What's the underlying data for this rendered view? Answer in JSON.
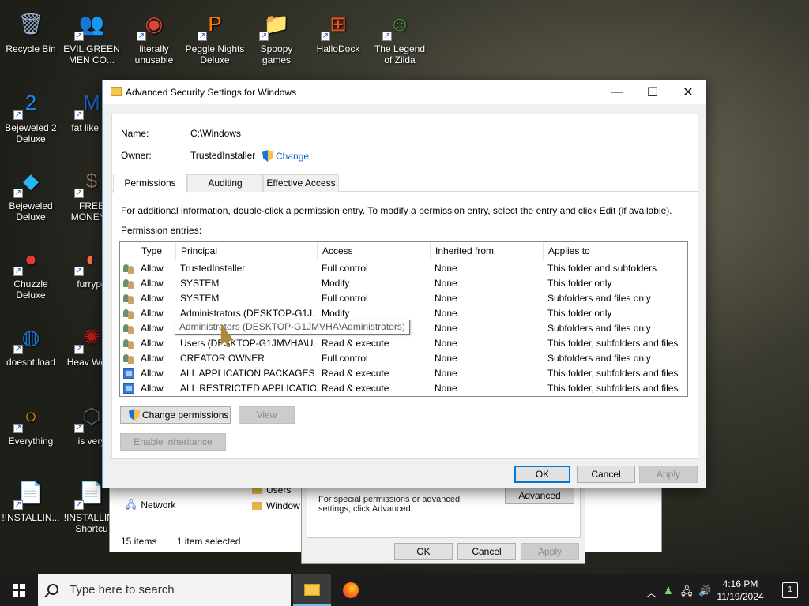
{
  "desktop": {
    "icons": [
      {
        "label": "Recycle Bin",
        "glyph": "🗑"
      },
      {
        "label": "EVIL GREEN MEN CO...",
        "glyph": "👥"
      },
      {
        "label": "literally unusable",
        "glyph": "◉"
      },
      {
        "label": "Peggle Nights Deluxe",
        "glyph": "P"
      },
      {
        "label": "Spoopy games",
        "glyph": "📁"
      },
      {
        "label": "HalloDock",
        "glyph": "⊞"
      },
      {
        "label": "The Legend of Zilda",
        "glyph": "☺"
      },
      {
        "label": "Bejeweled 2 Deluxe",
        "glyph": "2"
      },
      {
        "label": "fat like da",
        "glyph": "M"
      },
      {
        "label": "Bejeweled Deluxe",
        "glyph": "◆"
      },
      {
        "label": "FREE MONEY.e",
        "glyph": "$"
      },
      {
        "label": "Chuzzle Deluxe",
        "glyph": "●"
      },
      {
        "label": "furrypo",
        "glyph": "◐"
      },
      {
        "label": "doesnt load",
        "glyph": "◍"
      },
      {
        "label": "Heav Weap",
        "glyph": "✺"
      },
      {
        "label": "Everything",
        "glyph": "○"
      },
      {
        "label": "is very",
        "glyph": "⬡"
      },
      {
        "label": "!INSTALLIN...",
        "glyph": "📄"
      },
      {
        "label": "!INSTALLIN - Shortcu",
        "glyph": "📄"
      }
    ]
  },
  "background_explorer": {
    "nav_network": "Network",
    "folders": [
      "Users",
      "Window"
    ],
    "status_items": "15 items",
    "status_selected": "1 item selected"
  },
  "background_props": {
    "text": "For special permissions or advanced settings, click Advanced.",
    "advanced_button": "Advanced",
    "ok": "OK",
    "cancel": "Cancel",
    "apply": "Apply"
  },
  "dialog": {
    "title": "Advanced Security Settings for Windows",
    "name_label": "Name:",
    "name_value": "C:\\Windows",
    "owner_label": "Owner:",
    "owner_value": "TrustedInstaller",
    "owner_change": "Change",
    "tabs": [
      "Permissions",
      "Auditing",
      "Effective Access"
    ],
    "info_text": "For additional information, double-click a permission entry. To modify a permission entry, select the entry and click Edit (if available).",
    "entries_label": "Permission entries:",
    "columns": [
      "Type",
      "Principal",
      "Access",
      "Inherited from",
      "Applies to"
    ],
    "rows": [
      {
        "icon": "users-icon",
        "type": "Allow",
        "principal": "TrustedInstaller",
        "access": "Full control",
        "inherited": "None",
        "applies": "This folder and subfolders"
      },
      {
        "icon": "users-icon",
        "type": "Allow",
        "principal": "SYSTEM",
        "access": "Modify",
        "inherited": "None",
        "applies": "This folder only"
      },
      {
        "icon": "users-icon",
        "type": "Allow",
        "principal": "SYSTEM",
        "access": "Full control",
        "inherited": "None",
        "applies": "Subfolders and files only"
      },
      {
        "icon": "users-icon",
        "type": "Allow",
        "principal": "Administrators (DESKTOP-G1J...",
        "access": "Modify",
        "inherited": "None",
        "applies": "This folder only"
      },
      {
        "icon": "users-icon",
        "type": "Allow",
        "principal": "Administrators (DESKTOP-G1J...",
        "access": "Full control",
        "inherited": "None",
        "applies": "Subfolders and files only"
      },
      {
        "icon": "users-icon",
        "type": "Allow",
        "principal": "Users (DESKTOP-G1JMVHA\\U...",
        "access": "Read & execute",
        "inherited": "None",
        "applies": "This folder, subfolders and files"
      },
      {
        "icon": "users-icon",
        "type": "Allow",
        "principal": "CREATOR OWNER",
        "access": "Full control",
        "inherited": "None",
        "applies": "Subfolders and files only"
      },
      {
        "icon": "package-icon",
        "type": "Allow",
        "principal": "ALL APPLICATION PACKAGES",
        "access": "Read & execute",
        "inherited": "None",
        "applies": "This folder, subfolders and files"
      },
      {
        "icon": "package-icon",
        "type": "Allow",
        "principal": "ALL RESTRICTED APPLICATIO...",
        "access": "Read & execute",
        "inherited": "None",
        "applies": "This folder, subfolders and files"
      }
    ],
    "tooltip": "Administrators (DESKTOP-G1JMVHA\\Administrators)",
    "change_permissions": "Change permissions",
    "view": "View",
    "enable_inheritance": "Enable inheritance",
    "ok": "OK",
    "cancel": "Cancel",
    "apply": "Apply"
  },
  "taskbar": {
    "search_placeholder": "Type here to search",
    "time": "4:16 PM",
    "date": "11/19/2024",
    "notification_count": "1"
  }
}
